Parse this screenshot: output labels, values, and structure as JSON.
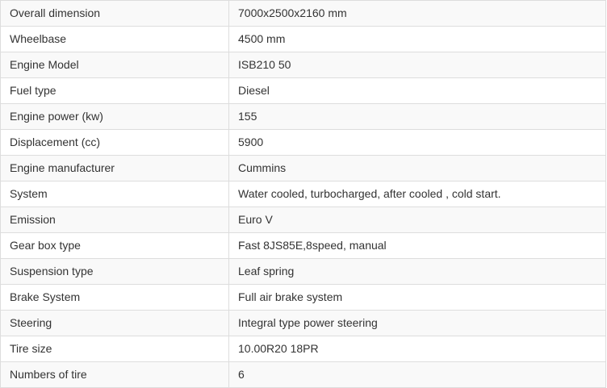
{
  "spec_table": {
    "rows": [
      {
        "label": "Overall dimension",
        "value": "7000x2500x2160 mm"
      },
      {
        "label": "Wheelbase",
        "value": "4500 mm"
      },
      {
        "label": "Engine Model",
        "value": "ISB210 50"
      },
      {
        "label": "Fuel type",
        "value": "Diesel"
      },
      {
        "label": "Engine power (kw)",
        "value": "155"
      },
      {
        "label": "Displacement (cc)",
        "value": "5900"
      },
      {
        "label": "Engine manufacturer",
        "value": "Cummins"
      },
      {
        "label": "System",
        "value": "Water cooled, turbocharged, after cooled , cold start."
      },
      {
        "label": "Emission",
        "value": "Euro V"
      },
      {
        "label": "Gear box type",
        "value": "Fast 8JS85E,8speed, manual"
      },
      {
        "label": "Suspension type",
        "value": "Leaf spring"
      },
      {
        "label": "Brake System",
        "value": "Full air brake system"
      },
      {
        "label": "Steering",
        "value": "Integral type power steering"
      },
      {
        "label": "Tire size",
        "value": "10.00R20 18PR"
      },
      {
        "label": "Numbers of tire",
        "value": "6"
      }
    ]
  }
}
